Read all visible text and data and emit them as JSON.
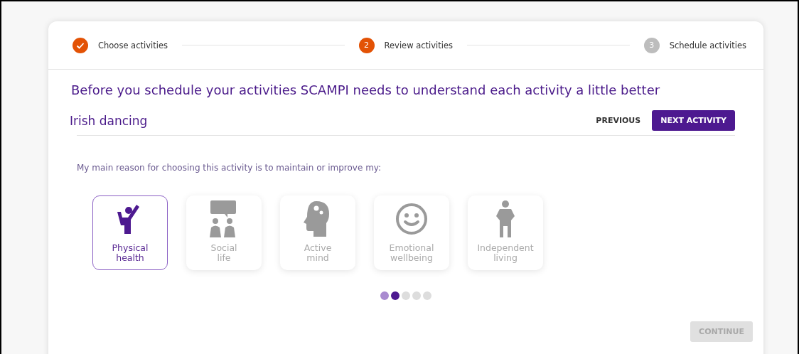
{
  "steps": [
    {
      "label": "Choose activities",
      "kind": "done"
    },
    {
      "number": "2",
      "label": "Review activities",
      "kind": "current"
    },
    {
      "number": "3",
      "label": "Schedule activities",
      "kind": "upcoming"
    }
  ],
  "heading": "Before you schedule your activities SCAMPI needs to understand each activity a little better",
  "activity": {
    "title": "Irish dancing",
    "previous": "PREVIOUS",
    "next": "NEXT ACTIVITY"
  },
  "question": "My main reason for choosing this activity is to maintain or improve my:",
  "reasons": [
    {
      "kind": "physical",
      "label": [
        "Physical",
        "health"
      ],
      "selected": true
    },
    {
      "kind": "social",
      "label": [
        "Social",
        "life"
      ],
      "selected": false
    },
    {
      "kind": "mind",
      "label": [
        "Active",
        "mind"
      ],
      "selected": false
    },
    {
      "kind": "emotional",
      "label": [
        "Emotional",
        "wellbeing"
      ],
      "selected": false
    },
    {
      "kind": "independent",
      "label": [
        "Independent",
        "living"
      ],
      "selected": false
    }
  ],
  "pager": [
    {
      "selected": false,
      "visited": true
    },
    {
      "selected": true
    },
    {
      "selected": false,
      "visited": false
    },
    {
      "selected": false,
      "visited": false
    },
    {
      "selected": false,
      "visited": false
    }
  ],
  "continue": {
    "label": "CONTINUE",
    "disabled": true
  }
}
